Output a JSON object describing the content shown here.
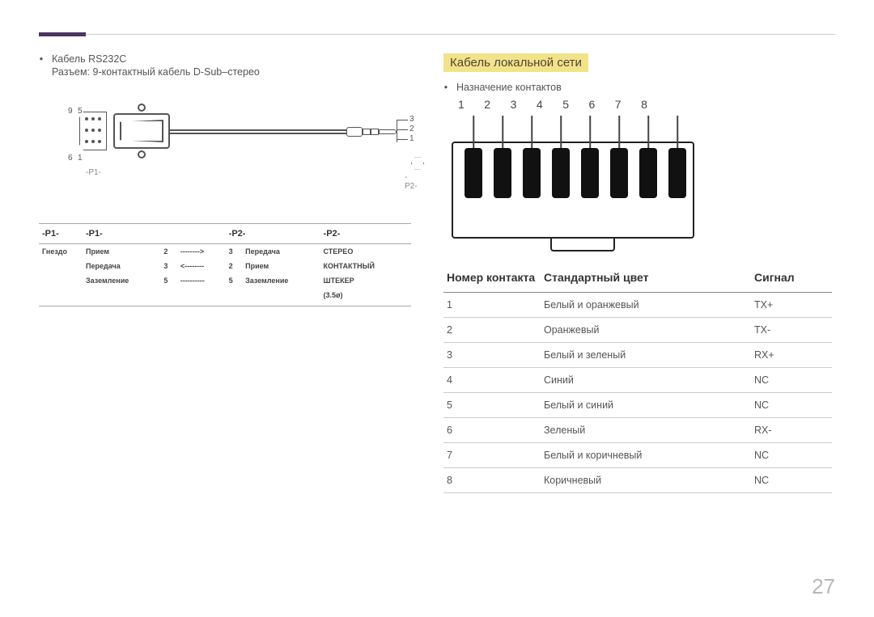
{
  "left": {
    "bullet_title": "Кабель RS232C",
    "connector_desc": "Разъем: 9-контактный кабель D-Sub–стерео",
    "pin_labels": {
      "n9": "9",
      "n5": "5",
      "n6": "6",
      "n1": "1",
      "j3": "3",
      "j2": "2",
      "jr1": "1"
    },
    "p1_caption": "-P1-",
    "p2_caption": "-P2-",
    "table": {
      "headers": [
        "-P1-",
        "-P1-",
        "-P2-",
        "-P2-"
      ],
      "sub": [
        "Гнездо",
        "",
        "",
        "",
        "",
        "",
        ""
      ],
      "rows": [
        [
          "",
          "Прием",
          "2",
          "-------->",
          "3",
          "Передача",
          "СТЕРЕО"
        ],
        [
          "",
          "Передача",
          "3",
          "<--------",
          "2",
          "Прием",
          "КОНТАКТНЫЙ"
        ],
        [
          "",
          "Заземление",
          "5",
          "----------",
          "5",
          "Заземление",
          "ШТЕКЕР"
        ],
        [
          "",
          "",
          "",
          "",
          "",
          "",
          "(3.5ø)"
        ]
      ]
    }
  },
  "right": {
    "heading": "Кабель локальной сети",
    "bullet": "Назначение контактов",
    "pin_numbers": [
      "1",
      "2",
      "3",
      "4",
      "5",
      "6",
      "7",
      "8"
    ],
    "table": {
      "headers": [
        "Номер контакта",
        "Стандартный цвет",
        "Сигнал"
      ],
      "rows": [
        [
          "1",
          "Белый и оранжевый",
          "TX+"
        ],
        [
          "2",
          "Оранжевый",
          "TX-"
        ],
        [
          "3",
          "Белый и зеленый",
          "RX+"
        ],
        [
          "4",
          "Синий",
          "NC"
        ],
        [
          "5",
          "Белый и синий",
          "NC"
        ],
        [
          "6",
          "Зеленый",
          "RX-"
        ],
        [
          "7",
          "Белый и коричневый",
          "NC"
        ],
        [
          "8",
          "Коричневый",
          "NC"
        ]
      ]
    }
  },
  "page_number": "27"
}
